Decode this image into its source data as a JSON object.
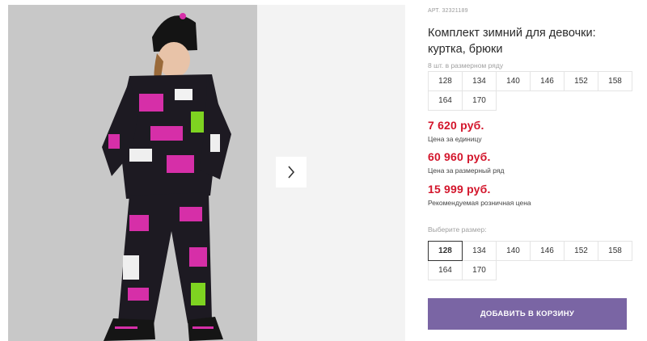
{
  "product": {
    "article_prefix": "АРТ.",
    "article_number": "32321189",
    "title": "Комплект зимний для девочки: куртка, брюки"
  },
  "size_row": {
    "caption": "8 шт. в размерном ряду",
    "sizes": [
      "128",
      "134",
      "140",
      "146",
      "152",
      "158",
      "164",
      "170"
    ]
  },
  "prices": [
    {
      "value": "7 620 руб.",
      "label": "Цена за единицу"
    },
    {
      "value": "60 960 руб.",
      "label": "Цена за размерный ряд"
    },
    {
      "value": "15 999 руб.",
      "label": "Рекомендуемая розничная цена"
    }
  ],
  "size_picker": {
    "caption": "Выберите размер:",
    "sizes": [
      "128",
      "134",
      "140",
      "146",
      "152",
      "158",
      "164",
      "170"
    ],
    "selected": "128"
  },
  "cart_button": {
    "label": "ДОБАВИТЬ В КОРЗИНУ"
  },
  "gallery": {
    "next_icon": "chevron-right-icon"
  },
  "colors": {
    "accent": "#7a65a4",
    "price": "#d3152b"
  }
}
